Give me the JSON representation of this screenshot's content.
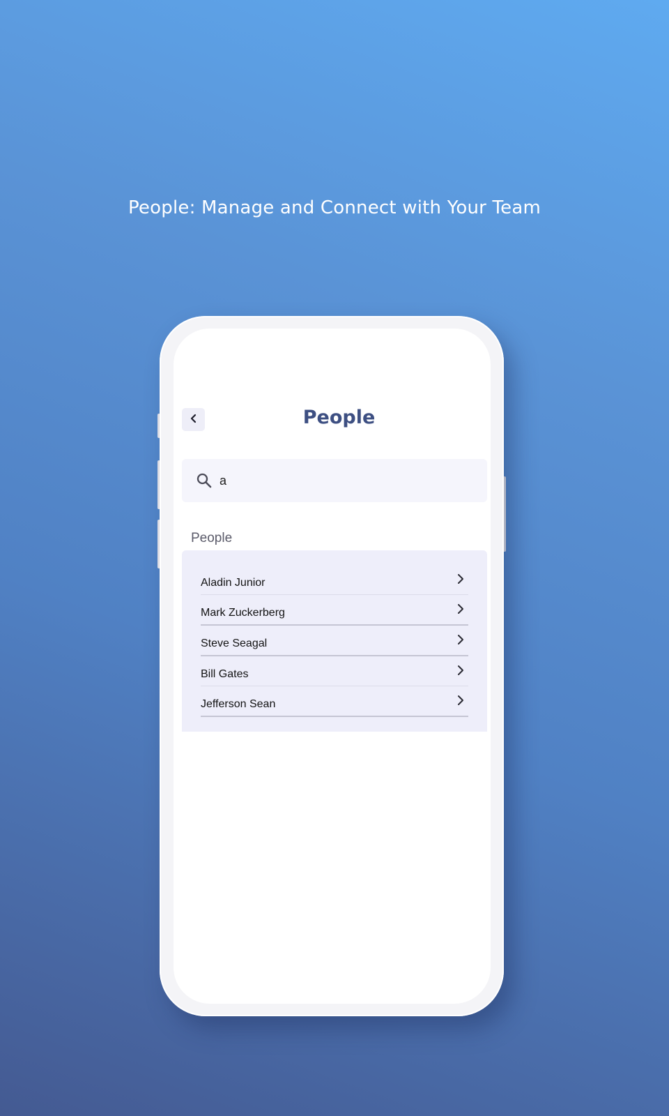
{
  "headline": "People: Manage and Connect with Your Team",
  "screen": {
    "title": "People",
    "back_icon": "chevron-left-icon",
    "search": {
      "icon": "search-icon",
      "value": "a"
    },
    "section_label": "People",
    "people": [
      {
        "name": "Aladin Junior"
      },
      {
        "name": "Mark Zuckerberg"
      },
      {
        "name": "Steve Seagal"
      },
      {
        "name": "Bill Gates"
      },
      {
        "name": "Jefferson Sean"
      }
    ]
  },
  "colors": {
    "title": "#3d4f82",
    "list_background": "#eeeefa",
    "search_background": "#f5f5fc"
  }
}
